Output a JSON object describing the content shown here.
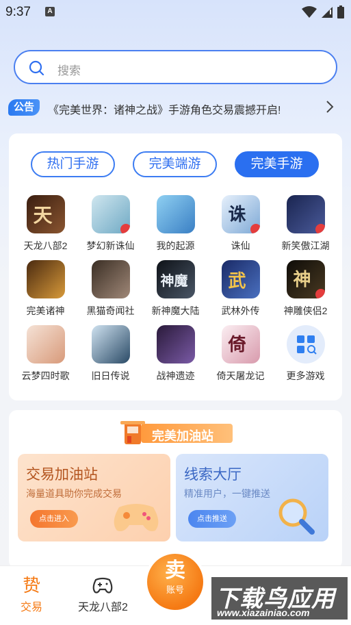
{
  "status_bar": {
    "time": "9:37",
    "a_label": "A"
  },
  "search": {
    "placeholder": "搜索"
  },
  "notice": {
    "badge": "公告",
    "text": "《完美世界：诸神之战》手游角色交易震撼开启!"
  },
  "tabs": [
    {
      "label": "热门手游",
      "active": false
    },
    {
      "label": "完美端游",
      "active": false
    },
    {
      "label": "完美手游",
      "active": true
    }
  ],
  "games": [
    {
      "label": "天龙八部2",
      "color": "#6b3a1e"
    },
    {
      "label": "梦幻新诛仙",
      "color": "#9fc9d8"
    },
    {
      "label": "我的起源",
      "color": "#5aa0d8"
    },
    {
      "label": "诛仙",
      "color": "#8fb4dc"
    },
    {
      "label": "新笑傲江湖",
      "color": "#2a3b6b"
    },
    {
      "label": "完美诸神",
      "color": "#b8742a"
    },
    {
      "label": "黑猫奇闻社",
      "color": "#6b5a4a"
    },
    {
      "label": "新神魔大陆",
      "color": "#2b3340"
    },
    {
      "label": "武林外传",
      "color": "#2a3f7a"
    },
    {
      "label": "神雕侠侣2",
      "color": "#1e1a14"
    },
    {
      "label": "云梦四时歌",
      "color": "#e2b8a0"
    },
    {
      "label": "旧日传说",
      "color": "#2a4a66"
    },
    {
      "label": "战神遗迹",
      "color": "#3a2a4a"
    },
    {
      "label": "倚天屠龙记",
      "color": "#e8c8d0"
    },
    {
      "label": "更多游戏",
      "color": "#e3ecfb"
    }
  ],
  "station": {
    "title": "完美加油站",
    "left_card": {
      "title": "交易加油站",
      "sub": "海量道具助你完成交易",
      "button": "点击进入"
    },
    "right_card": {
      "title": "线索大厅",
      "sub": "精准用户，一键推送",
      "button": "点击推送"
    }
  },
  "bottom_nav": {
    "trade": "交易",
    "trade_icon": "贽",
    "game": "天龙八部2",
    "sell_main": "卖",
    "sell_sub": "账号"
  },
  "watermark": {
    "main": "下载鸟应用",
    "sub": "www.xiazainiao.com"
  },
  "colors": {
    "accent": "#2a6ff0",
    "orange": "#f57a14"
  }
}
